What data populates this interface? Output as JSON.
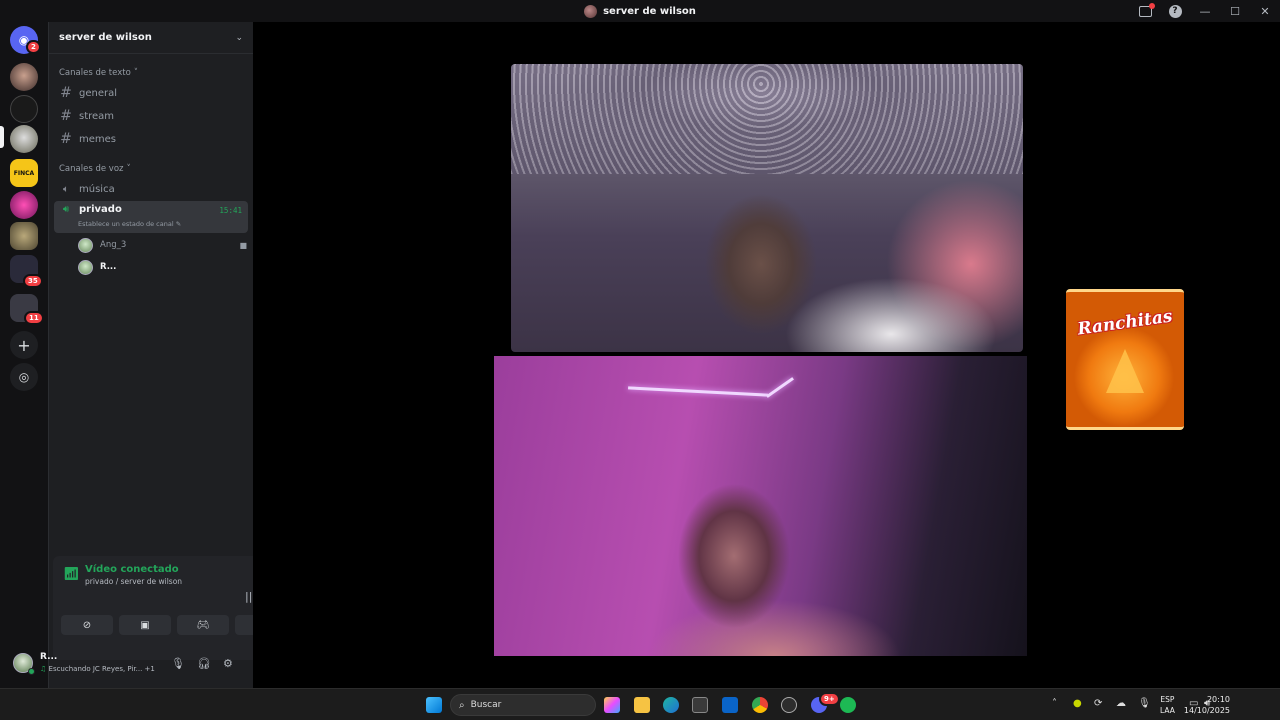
{
  "window": {
    "title": "server de wilson"
  },
  "rail": {
    "home_badge": "2",
    "badges": [
      {
        "count": "35"
      },
      {
        "count": "11"
      }
    ],
    "server_labels": {
      "finca": "FINCA"
    }
  },
  "sidebar": {
    "server_name": "server de wilson",
    "text_category": "Canales de texto",
    "text_channels": [
      {
        "name": "general"
      },
      {
        "name": "stream"
      },
      {
        "name": "memes"
      }
    ],
    "voice_category": "Canales de voz",
    "voice_channels": [
      {
        "name": "música"
      },
      {
        "name": "privado",
        "time": "15:41",
        "status_placeholder": "Establece un estado de canal"
      }
    ],
    "voice_users": [
      {
        "name": "Ang_3"
      },
      {
        "name": "R..."
      }
    ]
  },
  "voice_panel": {
    "status": "Vídeo conectado",
    "location": "privado / server de wilson"
  },
  "user_panel": {
    "name": "R...",
    "activity": "Escuchando JC Reyes, Pir... +1"
  },
  "stage": {
    "snack_brand": "Ranchitas"
  },
  "taskbar": {
    "search_placeholder": "Buscar",
    "lang_line1": "ESP",
    "lang_line2": "LAA",
    "time": "20:10",
    "date": "14/10/2025",
    "discord_badge": "9+"
  },
  "colors": {
    "accent_green": "#23a55a",
    "badge_red": "#f23f43",
    "sidebar_bg": "#1e1f22",
    "rail_bg": "#121214"
  }
}
